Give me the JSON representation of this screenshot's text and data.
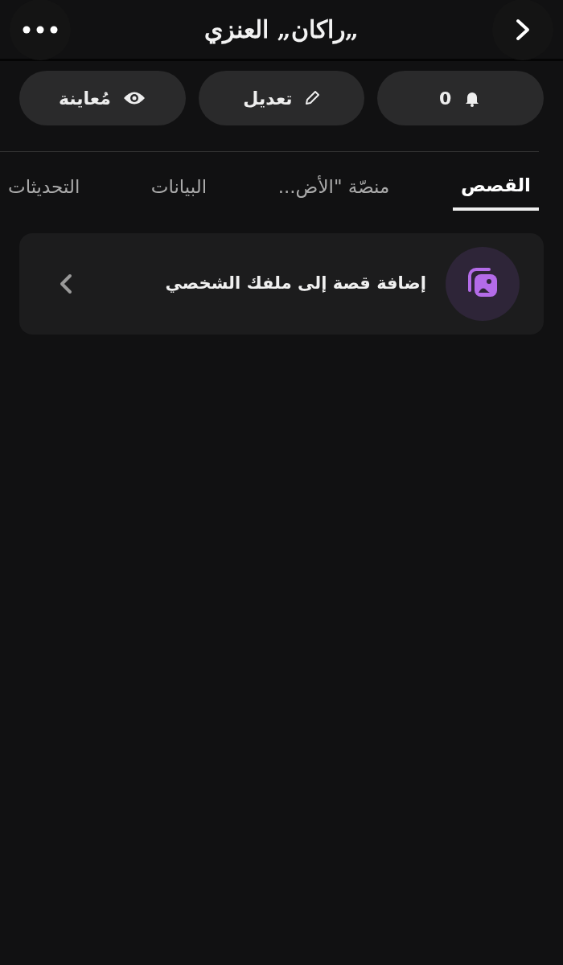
{
  "header": {
    "title": "„راكان„ العنزي"
  },
  "actions": [
    {
      "kind": "notifications",
      "label": "0"
    },
    {
      "kind": "edit",
      "label": "تعديل"
    },
    {
      "kind": "preview",
      "label": "مُعاينة"
    }
  ],
  "tabs": [
    {
      "label": "القصص",
      "selected": true
    },
    {
      "label": "منصّة \"الأض...",
      "selected": false
    },
    {
      "label": "البيانات",
      "selected": false
    },
    {
      "label": "التحديثات",
      "selected": false
    }
  ],
  "story_card": {
    "label": "إضافة قصة إلى ملفك الشخصي"
  }
}
